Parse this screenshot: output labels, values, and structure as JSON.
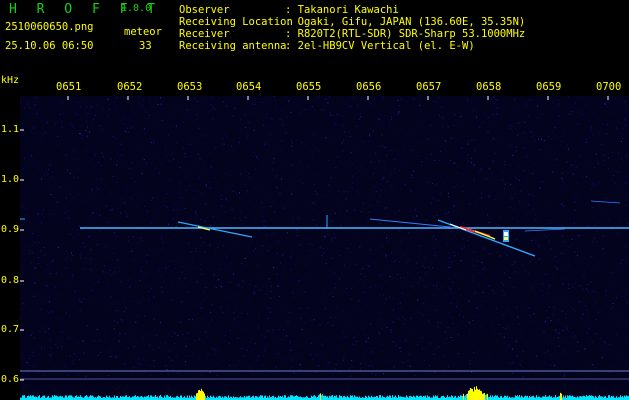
{
  "header": {
    "brand": "H R O F F T",
    "version": "1.0.0",
    "filename": "2510060650.png",
    "meteor_label": "meteor",
    "timestamp": "25.10.06 06:50",
    "meteor_count": "33"
  },
  "info": [
    {
      "key": "Observer",
      "value": ": Takanori Kawachi"
    },
    {
      "key": "Receiving Location",
      "value": ": Ogaki, Gifu, JAPAN (136.60E, 35.35N)"
    },
    {
      "key": "Receiver",
      "value": ": R820T2(RTL-SDR) SDR-Sharp 53.1000MHz"
    },
    {
      "key": "Receiving antenna",
      "value": ": 2el-HB9CV Vertical (el. E-W)"
    }
  ],
  "axis": {
    "unit": "kHz",
    "x_ticks": [
      "0651",
      "0652",
      "0653",
      "0654",
      "0655",
      "0656",
      "0657",
      "0658",
      "0659",
      "0700"
    ],
    "y_ticks": [
      "1.1",
      "1.0",
      "0.9",
      "0.8",
      "0.7",
      "0.6"
    ]
  },
  "colors": {
    "text": "#ffff00",
    "brand": "#14d214",
    "background": "#000000",
    "noise": "#0a0a5a",
    "carrier": "#2fa8ff",
    "echo": "#ff3030",
    "level_bar": "#00e5ff",
    "level_peak": "#ffff00"
  }
}
